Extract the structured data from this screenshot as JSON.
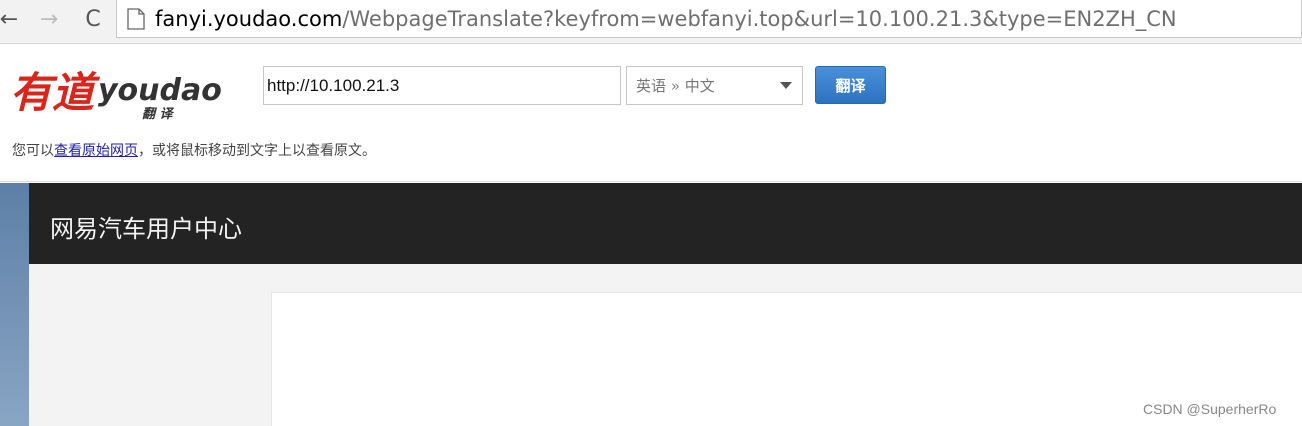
{
  "browser": {
    "nav": {
      "back_glyph": "←",
      "forward_glyph": "→",
      "reload_glyph": "C"
    },
    "address_bar": {
      "url_host": "fanyi.youdao.com",
      "url_path": "/WebpageTranslate?keyfrom=webfanyi.top&url=10.100.21.3&type=EN2ZH_CN"
    }
  },
  "youdao_bar": {
    "logo": {
      "chinese": "有道",
      "latin": "youdao",
      "sub": "翻译"
    },
    "url_input_value": "http://10.100.21.3",
    "language_select": {
      "selected": "英语 » 中文"
    },
    "translate_button": "翻译",
    "hint": {
      "before": "您可以",
      "link": "查看原始网页",
      "after": "，或将鼠标移动到文字上以查看原文。"
    }
  },
  "page": {
    "site_title": "网易汽车用户中心"
  },
  "watermark": "CSDN @SuperherRo",
  "colors": {
    "logo_red": "#d9261c",
    "button_blue": "#3a80cc",
    "header_dark": "#232323",
    "link_blue": "#2222aa"
  }
}
